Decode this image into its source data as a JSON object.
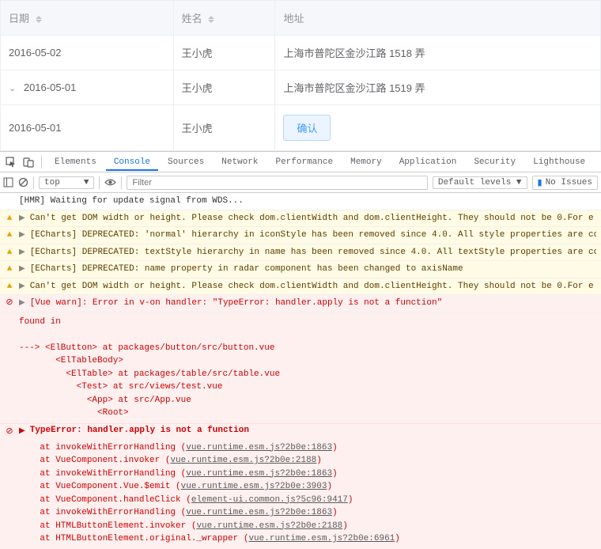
{
  "table": {
    "headers": {
      "date": "日期",
      "name": "姓名",
      "addr": "地址"
    },
    "rows": [
      {
        "date": "2016-05-02",
        "name": "王小虎",
        "addr": "上海市普陀区金沙江路 1518 弄",
        "expanded": false,
        "indent": 0
      },
      {
        "date": "2016-05-01",
        "name": "王小虎",
        "addr": "上海市普陀区金沙江路 1519 弄",
        "expanded": true,
        "indent": 0
      },
      {
        "date": "2016-05-01",
        "name": "王小虎",
        "addr": "",
        "button": "确认",
        "indent": 1
      }
    ]
  },
  "devtools": {
    "tabs": [
      "Elements",
      "Console",
      "Sources",
      "Network",
      "Performance",
      "Memory",
      "Application",
      "Security",
      "Lighthouse"
    ],
    "active_tab": "Console",
    "context": "top",
    "filter_placeholder": "Filter",
    "levels_label": "Default levels ▼",
    "issues_label": "No Issues"
  },
  "console": {
    "hmr": "[HMR] Waiting for update signal from WDS...",
    "warns": [
      "Can't get DOM width or height. Please check dom.clientWidth and dom.clientHeight. They should not be 0.For e",
      "[ECharts] DEPRECATED: 'normal' hierarchy in iconStyle has been removed since 4.0. All style properties are co",
      "[ECharts] DEPRECATED: textStyle hierarchy in name has been removed since 4.0. All textStyle properties are co",
      "[ECharts] DEPRECATED: name property in radar component has been changed to axisName",
      "Can't get DOM width or height. Please check dom.clientWidth and dom.clientHeight. They should not be 0.For e"
    ],
    "vue_error_head": "[Vue warn]: Error in v-on handler: \"TypeError: handler.apply is not a function\"",
    "vue_error_body": "found in\n\n---> <ElButton> at packages/button/src/button.vue\n       <ElTableBody>\n         <ElTable> at packages/table/src/table.vue\n           <Test> at src/views/test.vue\n             <App> at src/App.vue\n               <Root>",
    "type_error_head": "TypeError: handler.apply is not a function",
    "trace": [
      {
        "fn": "at invokeWithErrorHandling",
        "loc": "vue.runtime.esm.js?2b0e:1863"
      },
      {
        "fn": "at VueComponent.invoker",
        "loc": "vue.runtime.esm.js?2b0e:2188"
      },
      {
        "fn": "at invokeWithErrorHandling",
        "loc": "vue.runtime.esm.js?2b0e:1863"
      },
      {
        "fn": "at VueComponent.Vue.$emit",
        "loc": "vue.runtime.esm.js?2b0e:3903"
      },
      {
        "fn": "at VueComponent.handleClick",
        "loc": "element-ui.common.js?5c96:9417"
      },
      {
        "fn": "at invokeWithErrorHandling",
        "loc": "vue.runtime.esm.js?2b0e:1863"
      },
      {
        "fn": "at HTMLButtonElement.invoker",
        "loc": "vue.runtime.esm.js?2b0e:2188"
      },
      {
        "fn": "at HTMLButtonElement.original._wrapper",
        "loc": "vue.runtime.esm.js?2b0e:6961"
      }
    ]
  }
}
